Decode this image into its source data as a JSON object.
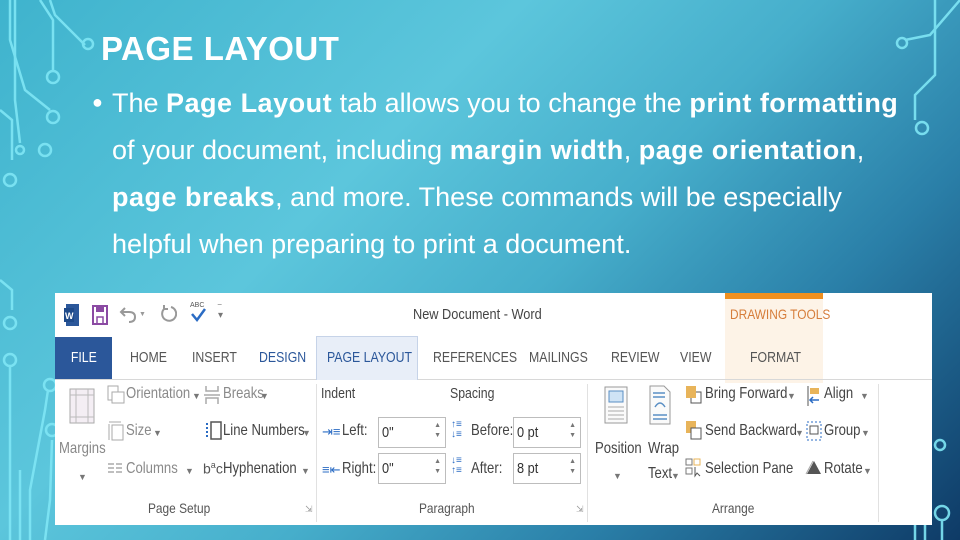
{
  "slide": {
    "title": "PAGE LAYOUT",
    "bullet": {
      "parts": [
        {
          "text": "The ",
          "bold": false
        },
        {
          "text": "Page Layout",
          "bold": true
        },
        {
          "text": " tab allows you to change the ",
          "bold": false
        },
        {
          "text": "print formatting",
          "bold": true
        },
        {
          "text": " of your document, including ",
          "bold": false
        },
        {
          "text": "margin width",
          "bold": true
        },
        {
          "text": ", ",
          "bold": false
        },
        {
          "text": "page orientation",
          "bold": true
        },
        {
          "text": ", ",
          "bold": false
        },
        {
          "text": "page breaks",
          "bold": true
        },
        {
          "text": ", and more. These commands will be especially helpful when preparing to print a document.",
          "bold": false
        }
      ]
    }
  },
  "word": {
    "window_title": "New Document - Word",
    "quick_access": [
      "word-logo-icon",
      "save-icon",
      "undo-icon",
      "redo-icon",
      "spelling-check-icon",
      "customize-qat-icon"
    ],
    "contextual_tab_group": "DRAWING TOOLS",
    "colors": {
      "file_tab": "#2b579a",
      "contextual": "#f0901f",
      "contextual_text": "#d67d3a"
    },
    "tabs": [
      {
        "label": "FILE"
      },
      {
        "label": "HOME"
      },
      {
        "label": "INSERT"
      },
      {
        "label": "DESIGN"
      },
      {
        "label": "PAGE LAYOUT",
        "active": true
      },
      {
        "label": "REFERENCES"
      },
      {
        "label": "MAILINGS"
      },
      {
        "label": "REVIEW"
      },
      {
        "label": "VIEW"
      },
      {
        "label": "FORMAT"
      }
    ],
    "page_setup": {
      "label": "Page Setup",
      "margins": "Margins",
      "orientation": "Orientation",
      "size": "Size",
      "columns": "Columns",
      "breaks": "Breaks",
      "line_numbers": "Line Numbers",
      "hyphenation": "Hyphenation"
    },
    "paragraph": {
      "label": "Paragraph",
      "indent_label": "Indent",
      "spacing_label": "Spacing",
      "left_label": "Left:",
      "left_value": "0\"",
      "right_label": "Right:",
      "right_value": "0\"",
      "before_label": "Before:",
      "before_value": "0 pt",
      "after_label": "After:",
      "after_value": "8 pt"
    },
    "arrange": {
      "label": "Arrange",
      "position": "Position",
      "wrap_text_1": "Wrap",
      "wrap_text_2": "Text",
      "bring_forward": "Bring Forward",
      "send_backward": "Send Backward",
      "selection_pane": "Selection Pane",
      "align": "Align",
      "group": "Group",
      "rotate": "Rotate"
    }
  }
}
